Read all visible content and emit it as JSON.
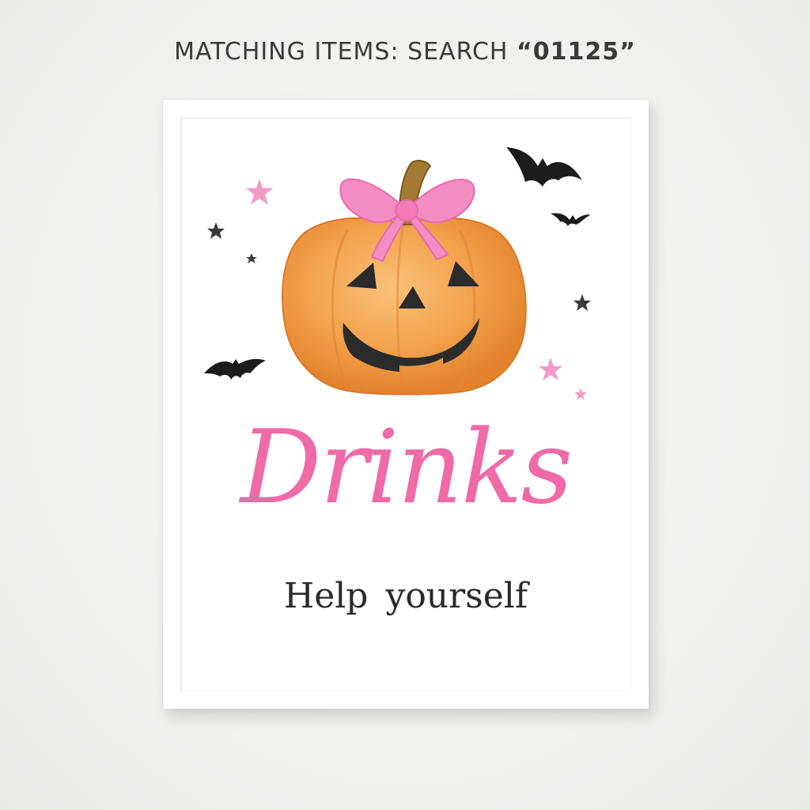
{
  "header": {
    "prefix": "MATCHING ITEMS: SEARCH ",
    "code": "“01125”"
  },
  "sign": {
    "title": "Drinks",
    "subtitle": "Help yourself"
  },
  "colors": {
    "title_pink": "#f06aa8",
    "pumpkin_orange": "#f3a14a",
    "bow_pink": "#f48cc4",
    "bat_black": "#1c1c1c"
  },
  "icons": [
    "pumpkin-icon",
    "bow-icon",
    "bat-icon",
    "star-icon"
  ]
}
